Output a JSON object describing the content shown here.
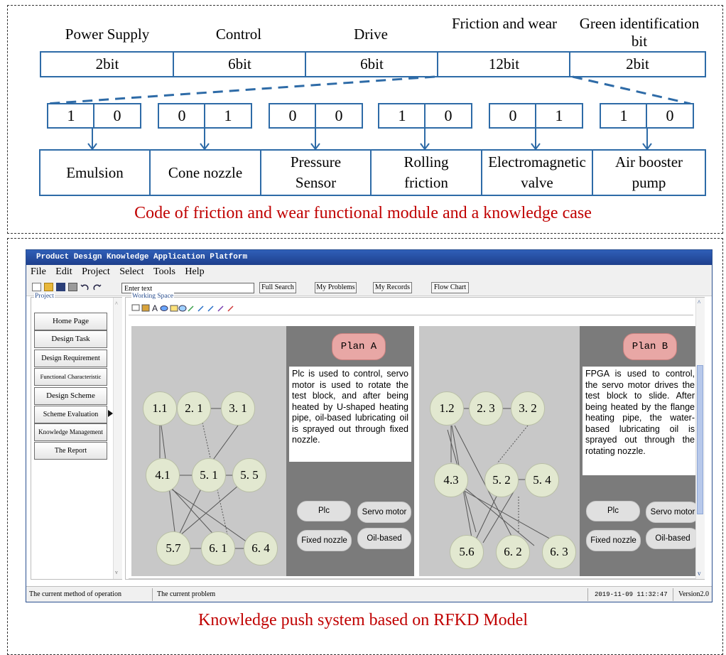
{
  "top_section": {
    "headers": [
      "Power Supply",
      "Control",
      "Drive",
      "Friction and wear",
      "Green identification bit"
    ],
    "bits": [
      "2bit",
      "6bit",
      "6bit",
      "12bit",
      "2bit"
    ],
    "code_pairs": [
      [
        "1",
        "0"
      ],
      [
        "0",
        "1"
      ],
      [
        "0",
        "0"
      ],
      [
        "1",
        "0"
      ],
      [
        "0",
        "1"
      ],
      [
        "1",
        "0"
      ]
    ],
    "components": [
      "Emulsion",
      "Cone nozzle",
      "Pressure Sensor",
      "Rolling friction",
      "Electromagnetic valve",
      "Air booster pump"
    ],
    "caption": "Code of friction and wear functional module and a knowledge case",
    "colors": {
      "box_border": "#2e6ba7",
      "caption": "#c00000"
    }
  },
  "app": {
    "title": "Product Design Knowledge Application Platform",
    "menu": [
      "File",
      "Edit",
      "Project",
      "Select",
      "Tools",
      "Help"
    ],
    "search_placeholder": "Enter text",
    "buttons": {
      "full_search": "Full Search",
      "my_problems": "My Problems",
      "my_records": "My Records",
      "flow_chart": "Flow Chart"
    },
    "project_label": "Project",
    "nav": [
      "Home Page",
      "Design Task",
      "Design Requirement",
      "Functional Characteristic",
      "Design Scheme",
      "Scheme Evaluation",
      "Knowledge Management",
      "The Report"
    ],
    "workspace_label": "Working Space",
    "plan_a": {
      "name": "Plan A",
      "description": "Plc is used to control, servo motor is used to rotate the test block, and after being heated by U-shaped heating pipe, oil-based lubricating oil is sprayed out through fixed nozzle.",
      "tags": [
        "Plc",
        "Servo motor",
        "Fixed nozzle",
        "Oil-based"
      ],
      "nodes": [
        "1.1",
        "2. 1",
        "3. 1",
        "4.1",
        "5. 1",
        "5. 5",
        "5.7",
        "6. 1",
        "6. 4"
      ]
    },
    "plan_b": {
      "name": "Plan B",
      "description": "FPGA is used to control, the servo motor drives the test block to slide. After being heated by the flange heating pipe, the water-based lubricating oil is sprayed out through the rotating nozzle.",
      "tags": [
        "Plc",
        "Servo motor",
        "Fixed nozzle",
        "Oil-based"
      ],
      "nodes": [
        "1.2",
        "2. 3",
        "3. 2",
        "4.3",
        "5. 2",
        "5. 4",
        "5.6",
        "6. 2",
        "6. 3"
      ]
    },
    "status": {
      "method": "The current method of operation",
      "problem": "The current problem",
      "datetime": "2019-11-09 11:32:47",
      "version": "Version2.0"
    },
    "colors": {
      "titlebar": "#2f5fb8",
      "plan_bg": "#c8c8c8",
      "plan_panel": "#7b7b7b",
      "plan_button": "#e8a7a5",
      "node_fill": "#e2e8d0"
    }
  },
  "bottom_caption": "Knowledge push system based on RFKD Model"
}
